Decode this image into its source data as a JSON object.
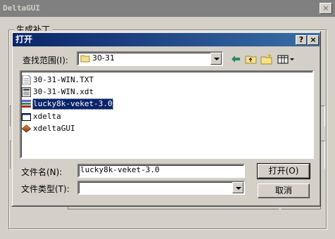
{
  "outer_window": {
    "title": "DeltaGUI",
    "close_label": "×",
    "group_label": "生成补丁"
  },
  "dialog": {
    "title": "打开",
    "help_label": "?",
    "close_label": "×",
    "lookin_label": "查找范围(I):",
    "lookin_value": "30-31",
    "filename_label": "文件名(N):",
    "filename_value": "lucky8k-veket-3.0",
    "filetype_label": "文件类型(T):",
    "filetype_value": "",
    "open_button": "打开(O)",
    "cancel_button": "取消",
    "files": [
      {
        "name": "30-31-WIN.TXT",
        "icon": "text-file-icon"
      },
      {
        "name": "30-31-WIN.xdt",
        "icon": "xdt-file-icon"
      },
      {
        "name": "lucky8k-veket-3.0",
        "icon": "archive-file-icon",
        "selected": true
      },
      {
        "name": "xdelta",
        "icon": "exe-window-icon"
      },
      {
        "name": "xdeltaGUI",
        "icon": "diamond-app-icon"
      }
    ]
  }
}
